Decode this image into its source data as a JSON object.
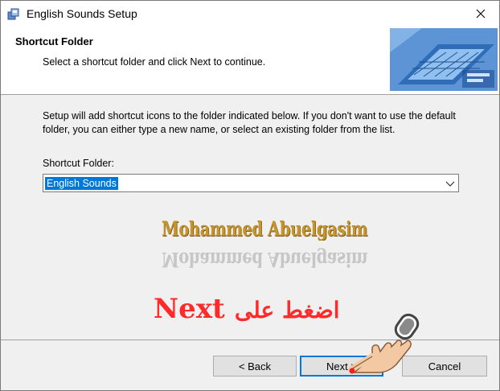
{
  "window": {
    "title": "English Sounds Setup"
  },
  "icons": {
    "app": "setup-app-icon",
    "close": "close-icon",
    "dropdown": "chevron-down-icon",
    "hand": "pointing-hand-icon"
  },
  "header": {
    "title": "Shortcut Folder",
    "subtitle": "Select a shortcut folder and click Next to continue."
  },
  "content": {
    "description": "Setup will add shortcut icons to the folder indicated below. If you don't want to use the default folder, you can either type a new name, or select an existing folder from the list.",
    "folder_label": "Shortcut Folder:",
    "folder_value": "English Sounds"
  },
  "overlay": {
    "signature": "Mohammed Abuelgasim",
    "instruction_en": "Next",
    "instruction_ar": "اضغط على"
  },
  "buttons": {
    "back": "< Back",
    "next": "Next >",
    "cancel": "Cancel"
  },
  "colors": {
    "accent": "#0078d7",
    "signature": "#c5942e",
    "instruction": "#ff2a2a"
  }
}
